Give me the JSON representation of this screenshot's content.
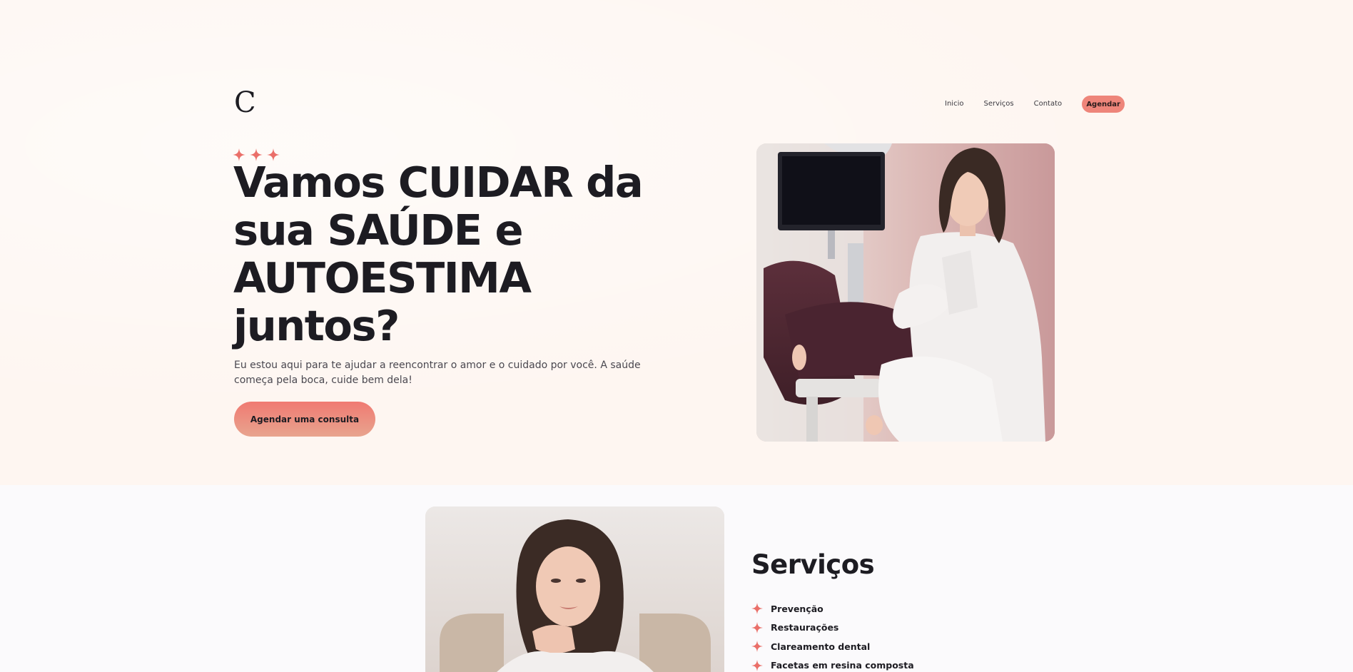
{
  "brand": {
    "logo_letter": "C"
  },
  "nav": {
    "items": [
      {
        "label": "Inicio"
      },
      {
        "label": "Serviços"
      },
      {
        "label": "Contato"
      }
    ],
    "cta_label": "Agendar"
  },
  "hero": {
    "headline_lines": [
      "Vamos CUIDAR da",
      "sua SAÚDE e",
      "AUTOESTIMA",
      "juntos?"
    ],
    "lead": "Eu estou aqui para te ajudar a reencontrar o amor e o cuidado por você. A saúde começa pela boca, cuide bem dela!",
    "cta_label": "Agendar uma consulta"
  },
  "services": {
    "title": "Serviços",
    "items": [
      {
        "label": "Prevenção"
      },
      {
        "label": "Restaurações"
      },
      {
        "label": "Clareamento dental"
      },
      {
        "label": "Facetas em resina composta"
      }
    ]
  },
  "colors": {
    "accent": "#ee857a",
    "sparkle": "#ea6f69",
    "text_dark": "#1d1c22",
    "hero_bg": "#fef6f1",
    "section_bg": "#fbfafc"
  },
  "icons": {
    "sparkle": "four-point-star-icon"
  }
}
